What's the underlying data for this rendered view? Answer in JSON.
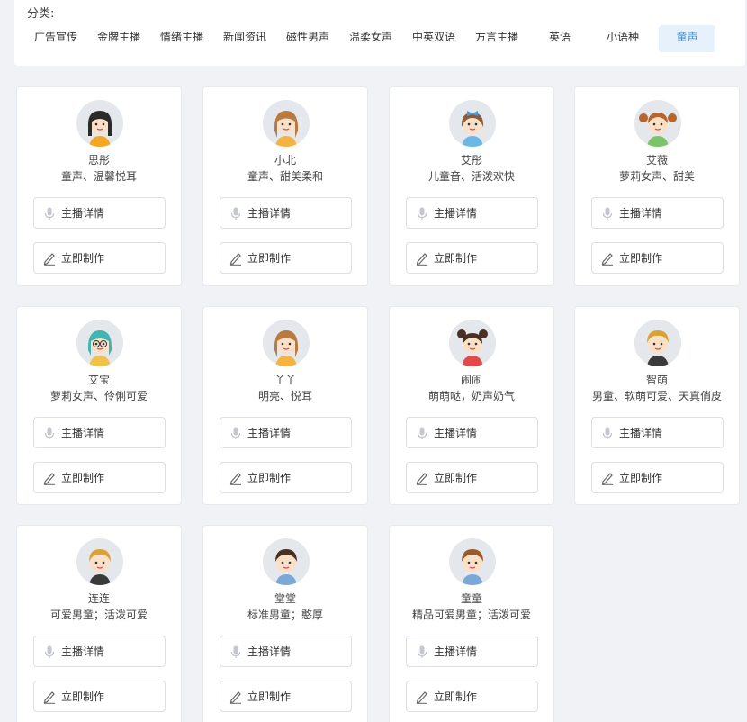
{
  "categories": {
    "label": "分类:",
    "items": [
      "广告宣传",
      "金牌主播",
      "情绪主播",
      "新闻资讯",
      "磁性男声",
      "温柔女声",
      "中英双语",
      "方言主播",
      "英语",
      "小语种",
      "童声"
    ],
    "active_index": 10
  },
  "buttons": {
    "detail_label": "主播详情",
    "make_label": "立即制作"
  },
  "colors": {
    "accent": "#3b8fd8",
    "active_bg": "#e6f1fc"
  },
  "voices": [
    {
      "name": "思彤",
      "desc": "童声、温馨悦耳",
      "avatar": "girl-black-hair"
    },
    {
      "name": "小北",
      "desc": "童声、甜美柔和",
      "avatar": "girl-brown-hair"
    },
    {
      "name": "艾彤",
      "desc": "儿童音、活泼欢快",
      "avatar": "girl-blue-bow"
    },
    {
      "name": "艾薇",
      "desc": "萝莉女声、甜美",
      "avatar": "girl-pigtails"
    },
    {
      "name": "艾宝",
      "desc": "萝莉女声、伶俐可爱",
      "avatar": "girl-teal-glasses"
    },
    {
      "name": "丫丫",
      "desc": "明亮、悦耳",
      "avatar": "girl-brown-hair"
    },
    {
      "name": "闹闹",
      "desc": "萌萌哒，奶声奶气",
      "avatar": "girl-buns"
    },
    {
      "name": "智萌",
      "desc": "男童、软萌可爱、天真俏皮",
      "avatar": "boy-blond"
    },
    {
      "name": "连连",
      "desc": "可爱男童；活泼可爱",
      "avatar": "boy-blond"
    },
    {
      "name": "堂堂",
      "desc": "标准男童；憨厚",
      "avatar": "boy-dark-hair"
    },
    {
      "name": "童童",
      "desc": "精品可爱男童；活泼可爱",
      "avatar": "boy-brown-hair"
    }
  ]
}
